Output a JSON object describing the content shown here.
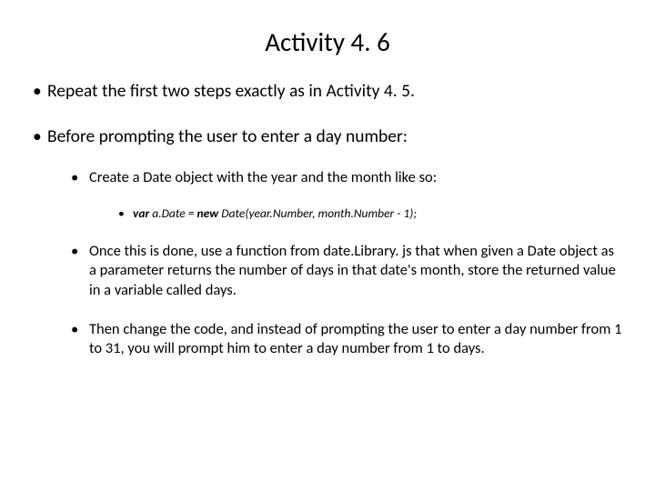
{
  "title": "Activity 4. 6",
  "bullets": {
    "b1": "Repeat the first two steps exactly as in Activity 4. 5.",
    "b2": "Before prompting the user to enter a day number:",
    "b2_1": "Create a Date object with the year and the month like so:",
    "b2_1_1_var": "var",
    "b2_1_1_mid": " a.Date = ",
    "b2_1_1_new": "new",
    "b2_1_1_rest": " Date(year.Number, month.Number - 1);",
    "b2_2": "Once this is done, use a function from date.Library. js that when given a Date object as a parameter returns the number of days in that date's month, store the returned value in a variable called days.",
    "b2_3": "Then change the code, and instead of prompting the user to enter a day number from 1 to 31, you will prompt him to enter a day number from 1 to days."
  }
}
